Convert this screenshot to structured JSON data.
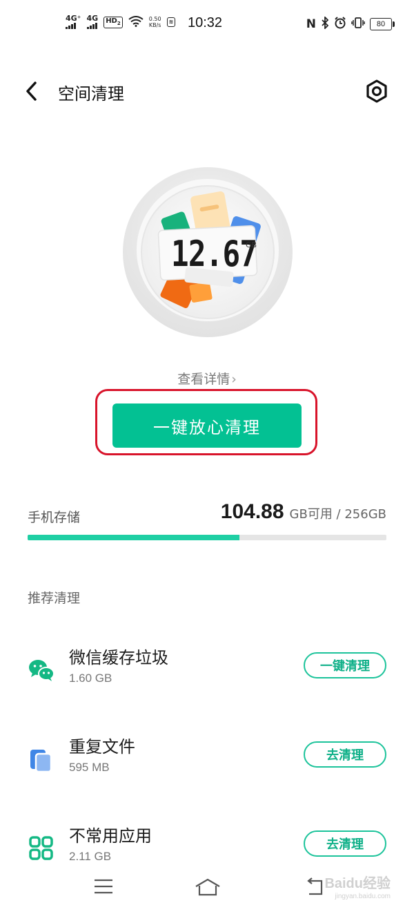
{
  "status_bar": {
    "net1": "4G⁺",
    "net2": "4G",
    "hd": "HD",
    "hd_sub": "2",
    "speed_value": "0.50",
    "speed_unit": "KB/s",
    "nfc": "N",
    "time": "10:32",
    "battery": "80"
  },
  "header": {
    "title": "空间清理"
  },
  "junk": {
    "value": "12.67",
    "unit": "GB",
    "details_link": "查看详情"
  },
  "primary_button": "一键放心清理",
  "storage": {
    "label": "手机存储",
    "available": "104.88",
    "suffix": "GB可用 / 256GB",
    "used_fraction": 0.59
  },
  "section_title": "推荐清理",
  "items": [
    {
      "name": "微信缓存垃圾",
      "size": "1.60 GB",
      "action": "一键清理",
      "icon": "wechat-icon"
    },
    {
      "name": "重复文件",
      "size": "595 MB",
      "action": "去清理",
      "icon": "duplicate-files-icon"
    },
    {
      "name": "不常用应用",
      "size": "2.11 GB",
      "action": "去清理",
      "icon": "apps-grid-icon"
    }
  ],
  "watermark": {
    "text": "Baidu经验",
    "sub": "jingyan.baidu.com"
  },
  "colors": {
    "accent": "#03c193",
    "highlight": "#d8132a"
  }
}
